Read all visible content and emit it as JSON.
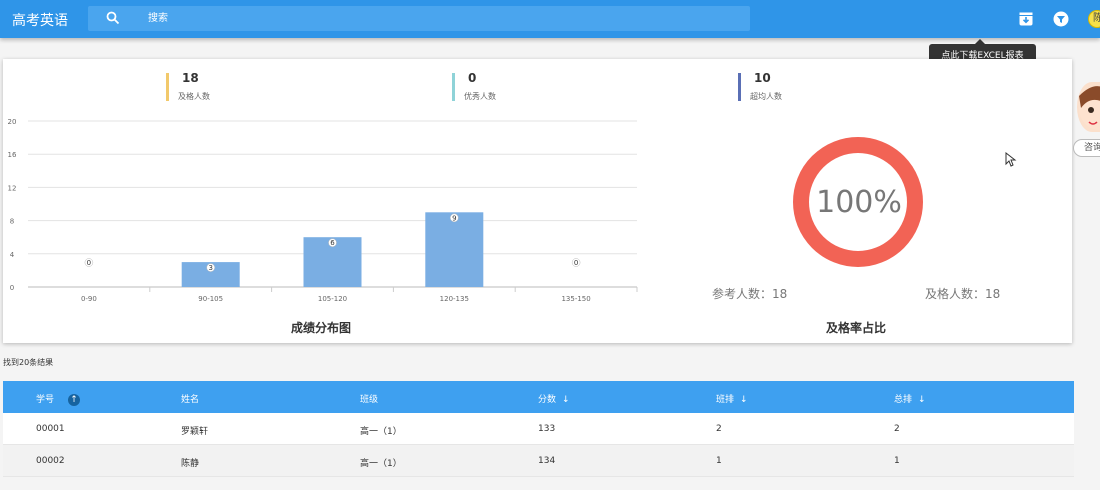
{
  "header": {
    "title": "高考英语",
    "search_placeholder": "搜索",
    "avatar_text": "陈"
  },
  "tooltip": "点此下载EXCEL报表",
  "stats": [
    {
      "value": "18",
      "label": "及格人数",
      "color": "#f2c96b"
    },
    {
      "value": "0",
      "label": "优秀人数",
      "color": "#8fd3d8"
    },
    {
      "value": "10",
      "label": "超均人数",
      "color": "#5a6fb5"
    }
  ],
  "chart_data": [
    {
      "type": "bar",
      "title": "成绩分布图",
      "categories": [
        "0-90",
        "90-105",
        "105-120",
        "120-135",
        "135-150"
      ],
      "values": [
        0,
        3,
        6,
        9,
        0
      ],
      "yticks": [
        0,
        4,
        8,
        12,
        16,
        20
      ],
      "ylim": [
        0,
        20
      ],
      "bar_color": "#7aaee3"
    },
    {
      "type": "pie",
      "title": "及格率占比",
      "center_label": "100%",
      "values": [
        100
      ],
      "color": "#f26355"
    }
  ],
  "donut": {
    "participants": "参考人数：18",
    "passed": "及格人数：18"
  },
  "side_button": "咨询",
  "result_count": "找到20条结果",
  "table": {
    "headers": [
      "学号",
      "姓名",
      "班级",
      "分数",
      "班排",
      "总排"
    ],
    "rows": [
      [
        "00001",
        "罗颖轩",
        "高一（1）",
        "133",
        "2",
        "2"
      ],
      [
        "00002",
        "陈静",
        "高一（1）",
        "134",
        "1",
        "1"
      ]
    ]
  }
}
